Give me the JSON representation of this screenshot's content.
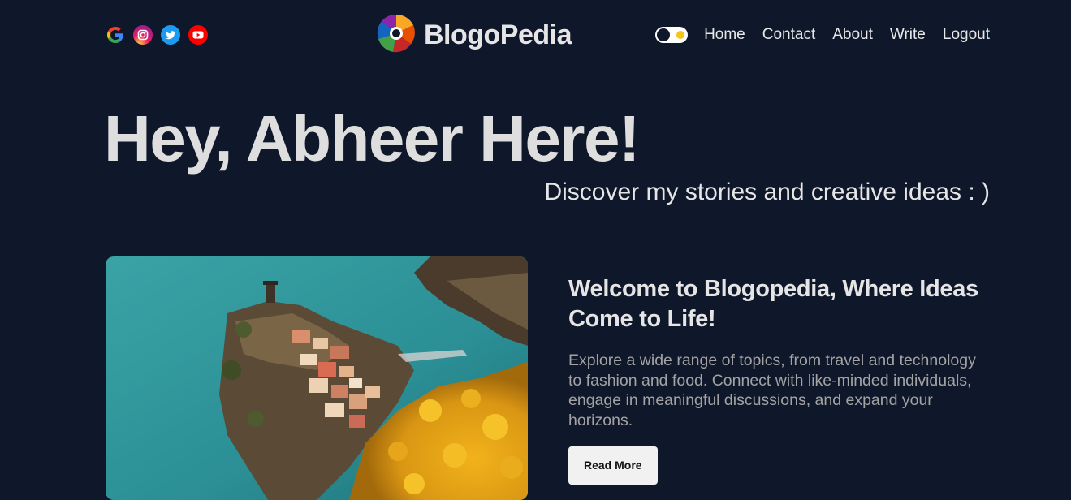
{
  "socials": [
    {
      "name": "google-icon"
    },
    {
      "name": "instagram-icon"
    },
    {
      "name": "twitter-icon"
    },
    {
      "name": "youtube-icon"
    }
  ],
  "brand": {
    "name": "BlogoPedia"
  },
  "nav": {
    "links": [
      "Home",
      "Contact",
      "About",
      "Write",
      "Logout"
    ]
  },
  "hero": {
    "title": "Hey, Abheer Here!",
    "subtitle": "Discover my stories and creative ideas : )"
  },
  "featured": {
    "title": "Welcome to Blogopedia, Where Ideas Come to Life!",
    "description": "Explore a wide range of topics, from travel and technology to fashion and food. Connect with like-minded individuals, engage in meaningful discussions, and expand your horizons.",
    "button": "Read More"
  },
  "colors": {
    "background": "#0f172a",
    "text": "#dddddd",
    "muted": "#a3a3a3",
    "accent_toggle": "#f5c518"
  }
}
